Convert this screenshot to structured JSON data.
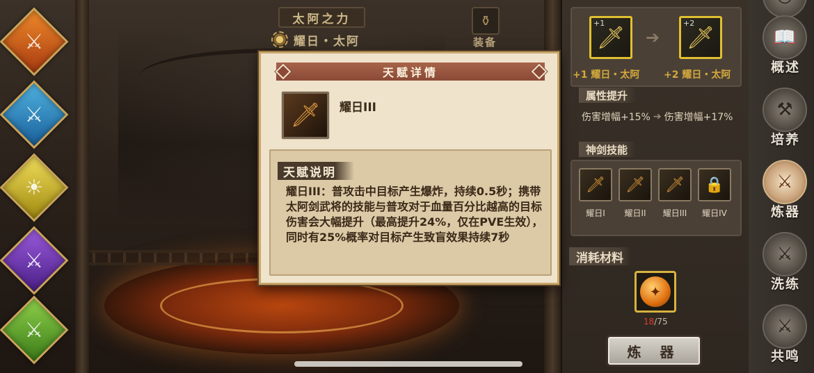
{
  "header": {
    "title": "太阿之力",
    "subtitle": "耀日・太阿",
    "equip_label": "装备"
  },
  "left_nav": {
    "icons": [
      "fire-sword-icon",
      "ice-sword-icon",
      "sun-sword-icon",
      "purple-sword-icon",
      "green-sword-icon"
    ]
  },
  "upgrade": {
    "from_level": "+1",
    "to_level": "+2",
    "from_label": "+1 耀日・太阿",
    "to_label": "+2 耀日・太阿"
  },
  "attributes": {
    "section_title": "属性提升",
    "from_value": "伤害增幅+15%",
    "to_value": "伤害增幅+17%"
  },
  "skills": {
    "section_title": "神剑技能",
    "items": [
      {
        "label": "耀日I"
      },
      {
        "label": "耀日II"
      },
      {
        "label": "耀日III"
      },
      {
        "label": "耀日IV"
      }
    ]
  },
  "materials": {
    "section_title": "消耗材料",
    "have": "18",
    "need": "/75",
    "have_color": "#e04030"
  },
  "refine_button": "炼 器",
  "right_nav": {
    "items": [
      {
        "label": ""
      },
      {
        "label": "概述"
      },
      {
        "label": "培养"
      },
      {
        "label": "炼器"
      },
      {
        "label": "洗练"
      },
      {
        "label": "共鸣"
      }
    ],
    "active": "炼器"
  },
  "dialog": {
    "title": "天赋详情",
    "talent_name": "耀日III",
    "desc_title": "天赋说明",
    "desc_text": "耀日III：普攻击中目标产生爆炸，持续0.5秒；携带太阿剑武将的技能与普攻对于血量百分比越高的目标伤害会大幅提升（最高提升24%，仅在PVE生效），同时有25%概率对目标产生致盲效果持续7秒"
  },
  "colors": {
    "accent_gold": "#d4a93c",
    "dialog_bg": "#efe3cc",
    "title_bar": "#8a4a36"
  }
}
